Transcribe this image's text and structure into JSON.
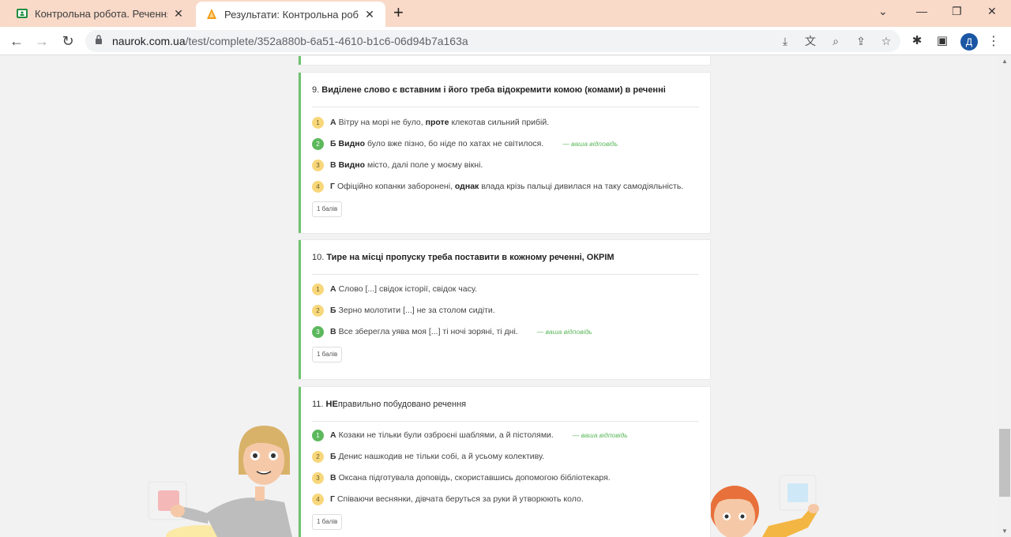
{
  "browser": {
    "tabs": [
      {
        "title": "Контрольна робота. Речення з с",
        "close": "✕"
      },
      {
        "title": "Результати: Контрольна робота",
        "close": "✕"
      }
    ],
    "new_tab": "+",
    "window_controls": {
      "minimize": "⌄",
      "restore": "—",
      "maximize": "❐",
      "close": "✕"
    },
    "url_host": "naurok.com.ua",
    "url_path": "/test/complete/352a880b-6a51-4610-b1c6-06d94b7a163a",
    "profile_initial": "Д"
  },
  "questions": [
    {
      "number": "9.",
      "title": "Виділене слово є вставним і його треба відокремити комою (комами) в реченні",
      "points": "1 балів",
      "options": [
        {
          "num": "1",
          "letter": "А",
          "pre": "Вітру на морі не було,",
          "bold": "проте",
          "post": "клекотав сильний прибій.",
          "correct": false,
          "note": ""
        },
        {
          "num": "2",
          "letter": "Б",
          "pre": "",
          "bold": "Видно",
          "post": "було вже пізно, бо ніде по хатах не світилося.",
          "correct": true,
          "note": "— ваша відповідь"
        },
        {
          "num": "3",
          "letter": "В",
          "pre": "",
          "bold": "Видно",
          "post": "місто, далі поле у моєму вікні.",
          "correct": false,
          "note": ""
        },
        {
          "num": "4",
          "letter": "Г",
          "pre": "Офіційно копанки заборонені,",
          "bold": "однак",
          "post": "влада крізь пальці дивилася на таку самодіяльність.",
          "correct": false,
          "note": ""
        }
      ]
    },
    {
      "number": "10.",
      "title": "Тире на місці пропуску треба поставити в кожному реченні, ОКРІМ",
      "points": "1 балів",
      "options": [
        {
          "num": "1",
          "letter": "А",
          "text": "Слово [...] свідок історії, свідок часу.",
          "correct": false,
          "note": ""
        },
        {
          "num": "2",
          "letter": "Б",
          "text": "Зерно молотити [...] не за столом сидіти.",
          "correct": false,
          "note": ""
        },
        {
          "num": "3",
          "letter": "В",
          "text": "Все зберегла уява моя [...] ті ночі зоряні, ті дні.",
          "correct": true,
          "note": "— ваша відповідь"
        }
      ]
    },
    {
      "number": "11.",
      "title_bold": "НЕ",
      "title_rest": "правильно побудовано речення",
      "points": "1 балів",
      "options": [
        {
          "num": "1",
          "letter": "А",
          "text": "Козаки не тільки були озброєні шаблями, а й пістолями.",
          "correct": true,
          "note": "— ваша відповідь"
        },
        {
          "num": "2",
          "letter": "Б",
          "text": "Денис нашкодив не тільки собі, а й усьому колективу.",
          "correct": false,
          "note": ""
        },
        {
          "num": "3",
          "letter": "В",
          "text": "Оксана підготувала доповідь, скориставшись допомогою бібліотекаря.",
          "correct": false,
          "note": ""
        },
        {
          "num": "4",
          "letter": "Г",
          "text": "Співаючи веснянки, дівчата беруться за руки й утворюють коло.",
          "correct": false,
          "note": ""
        }
      ]
    }
  ],
  "colors": {
    "tabstrip": "#f9d9c8",
    "correct_green": "#5cb85c",
    "option_yellow": "#f8d77b",
    "card_border": "#6fc26f"
  }
}
